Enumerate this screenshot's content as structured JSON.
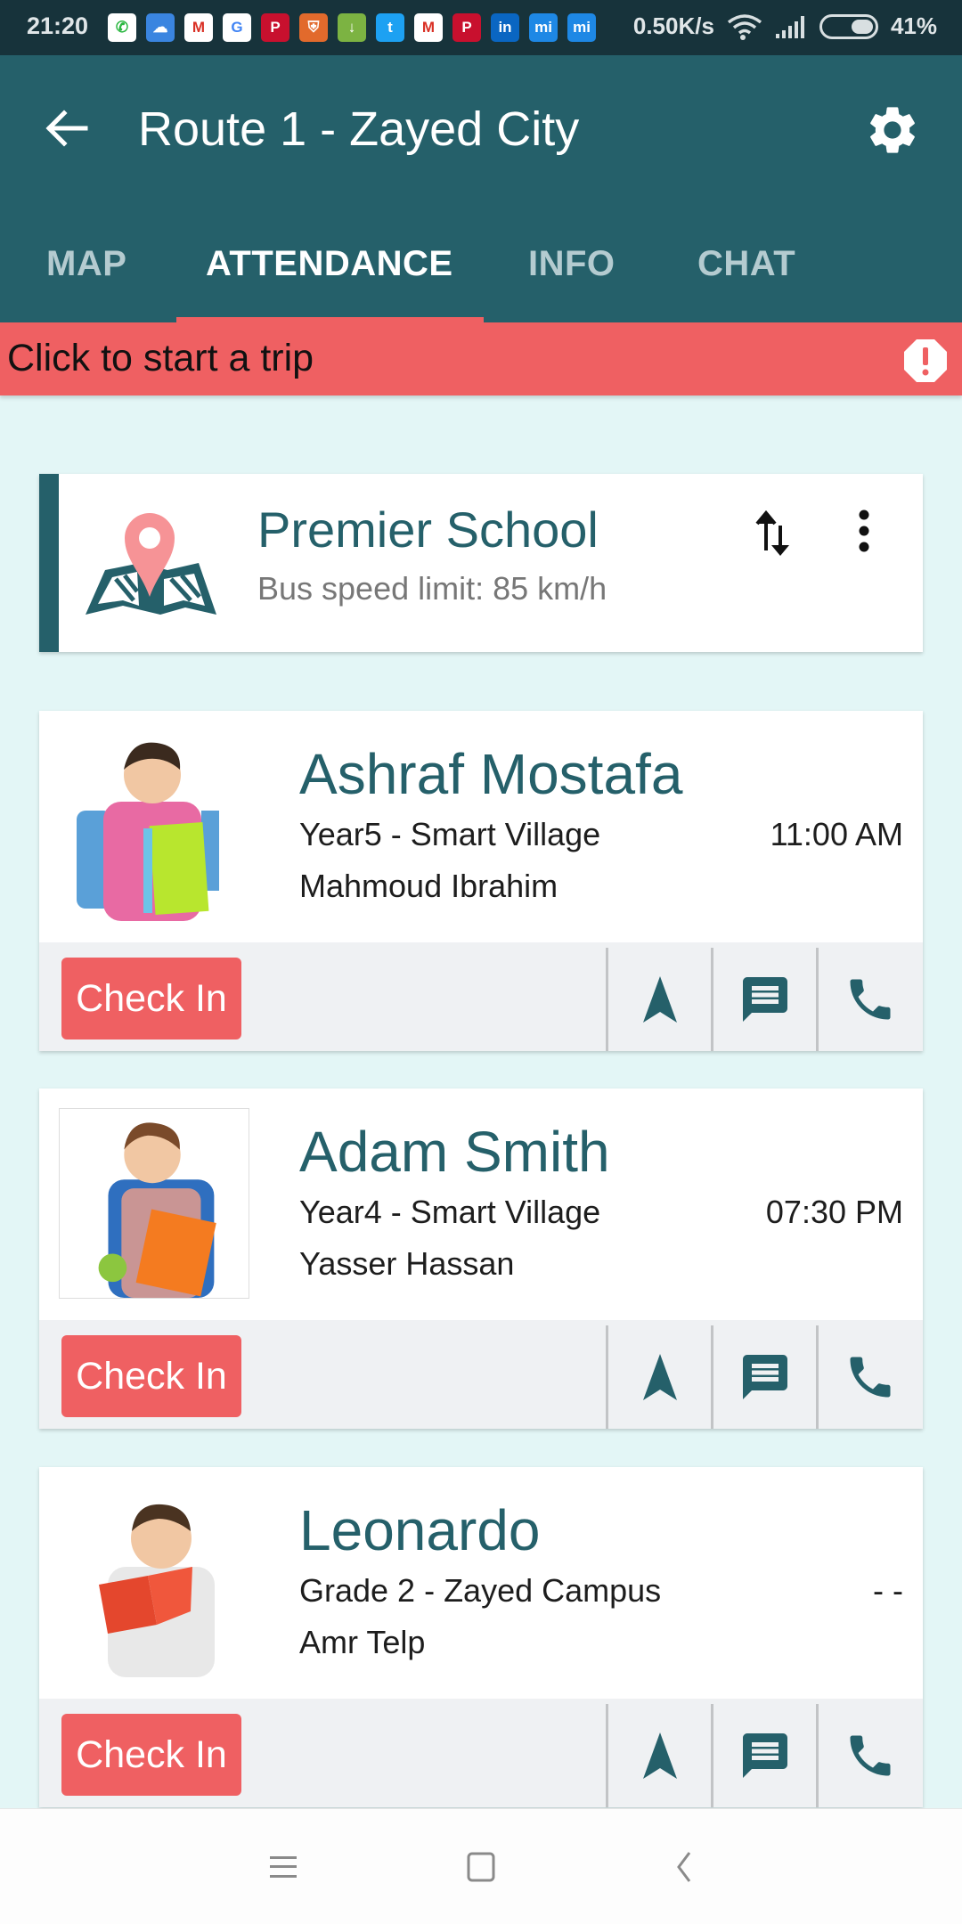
{
  "status_bar": {
    "time": "21:20",
    "notification_icons": [
      {
        "name": "whatsapp-icon",
        "glyph": "✆",
        "color": "#2bb741",
        "bg": "#ffffff"
      },
      {
        "name": "cloud-icon",
        "glyph": "☁",
        "color": "#ffffff",
        "bg": "#3a85e0"
      },
      {
        "name": "gmail-icon",
        "glyph": "M",
        "color": "#d93025",
        "bg": "#ffffff"
      },
      {
        "name": "google-icon",
        "glyph": "G",
        "color": "#4285f4",
        "bg": "#ffffff"
      },
      {
        "name": "pinterest-icon",
        "glyph": "P",
        "color": "#ffffff",
        "bg": "#c8102e"
      },
      {
        "name": "shield-icon",
        "glyph": "⛨",
        "color": "#ffffff",
        "bg": "#e26a2c"
      },
      {
        "name": "download-icon",
        "glyph": "↓",
        "color": "#ffffff",
        "bg": "#7cb342"
      },
      {
        "name": "twitter-icon",
        "glyph": "t",
        "color": "#ffffff",
        "bg": "#1da1f2"
      },
      {
        "name": "gmail-icon",
        "glyph": "M",
        "color": "#d93025",
        "bg": "#ffffff"
      },
      {
        "name": "pinterest-icon",
        "glyph": "P",
        "color": "#ffffff",
        "bg": "#c8102e"
      },
      {
        "name": "linkedin-icon",
        "glyph": "in",
        "color": "#ffffff",
        "bg": "#0a66c2"
      },
      {
        "name": "mi-icon",
        "glyph": "mi",
        "color": "#ffffff",
        "bg": "#1e88e5"
      },
      {
        "name": "mi-icon",
        "glyph": "mi",
        "color": "#ffffff",
        "bg": "#1e88e5"
      }
    ],
    "network_speed": "0.50K/s",
    "battery_percent": 41,
    "battery_label": "41%"
  },
  "app_bar": {
    "title": "Route 1 - Zayed City",
    "back_icon": "arrow-back-icon",
    "settings_icon": "gear-icon"
  },
  "tabs": [
    {
      "label": "MAP",
      "active": false
    },
    {
      "label": "ATTENDANCE",
      "active": true
    },
    {
      "label": "INFO",
      "active": false
    },
    {
      "label": "CHAT",
      "active": false
    }
  ],
  "banner": {
    "text": "Click to start a trip",
    "icon": "alert-octagon-icon"
  },
  "school": {
    "name": "Premier School",
    "speed_limit": "Bus speed limit: 85 km/h",
    "icon": "map-pin-icon"
  },
  "students": [
    {
      "name": "Ashraf Mostafa",
      "class": "Year5 - Smart Village",
      "time": "11:00 AM",
      "parent": "Mahmoud Ibrahim",
      "check_in_label": "Check In",
      "photo": "boy-with-backpack-and-green-notebook"
    },
    {
      "name": "Adam Smith",
      "class": "Year4 - Smart Village",
      "time": "07:30 PM",
      "parent": "Yasser Hassan",
      "check_in_label": "Check In",
      "photo": "boy-with-orange-folder-and-apple"
    },
    {
      "name": "Leonardo",
      "class": "Grade 2 - Zayed Campus",
      "time": "- -",
      "parent": "Amr Telp",
      "check_in_label": "Check In",
      "photo": "boy-reading-red-book"
    }
  ],
  "colors": {
    "primary": "#25606a",
    "accent": "#ef6062",
    "background": "#e3f6f6",
    "status_bar": "#17333b"
  }
}
